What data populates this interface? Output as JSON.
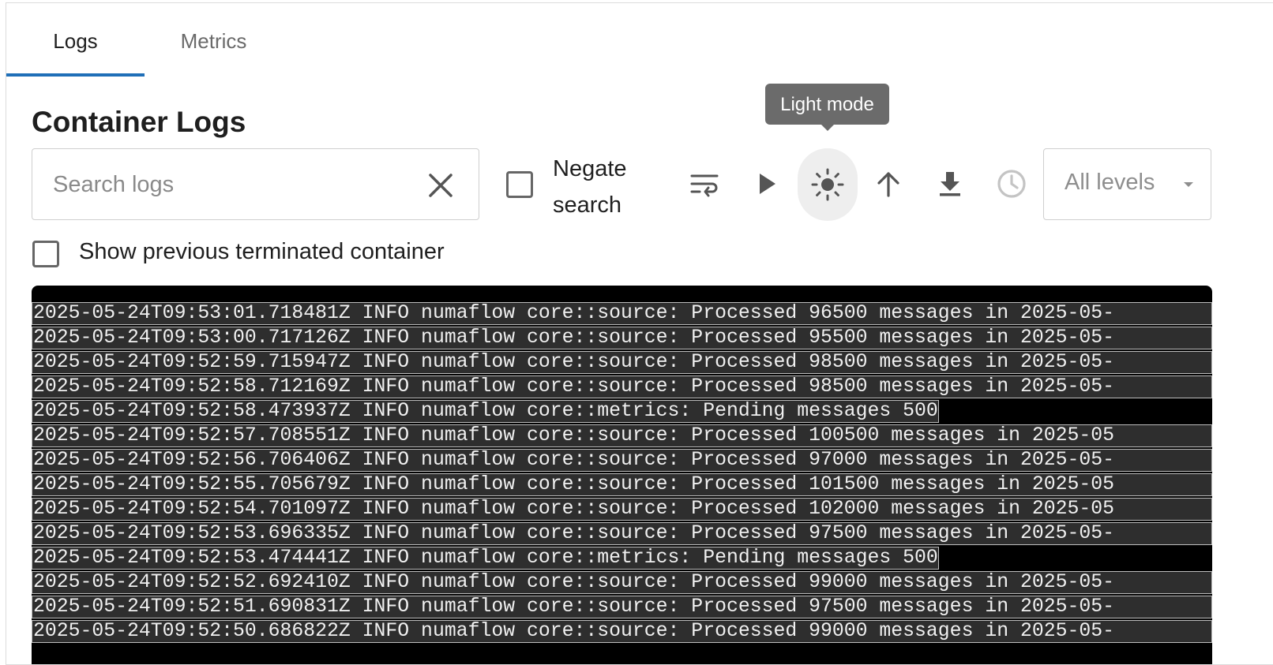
{
  "tabs": [
    {
      "label": "Logs",
      "active": true
    },
    {
      "label": "Metrics",
      "active": false
    }
  ],
  "title": "Container Logs",
  "search": {
    "placeholder": "Search logs",
    "value": ""
  },
  "negate": {
    "label": "Negate search",
    "checked": false
  },
  "toolbar": {
    "icons": [
      "wrap-icon",
      "play-icon",
      "sun-icon",
      "arrow-up-icon",
      "download-icon",
      "clock-icon"
    ],
    "tooltip": "Light mode"
  },
  "level_select": {
    "value": "All levels"
  },
  "show_previous": {
    "label": "Show previous terminated container",
    "checked": false
  },
  "accent_color": "#1f6fb8",
  "logs": [
    {
      "text": "2025-05-24T09:53:01.718481Z INFO numaflow core::source: Processed 96500 messages in 2025-05-",
      "short": false
    },
    {
      "text": "2025-05-24T09:53:00.717126Z INFO numaflow core::source: Processed 95500 messages in 2025-05-",
      "short": false
    },
    {
      "text": "2025-05-24T09:52:59.715947Z INFO numaflow core::source: Processed 98500 messages in 2025-05-",
      "short": false
    },
    {
      "text": "2025-05-24T09:52:58.712169Z INFO numaflow core::source: Processed 98500 messages in 2025-05-",
      "short": false
    },
    {
      "text": "2025-05-24T09:52:58.473937Z INFO numaflow core::metrics: Pending messages 500",
      "short": true
    },
    {
      "text": "2025-05-24T09:52:57.708551Z INFO numaflow core::source: Processed 100500 messages in 2025-05",
      "short": false
    },
    {
      "text": "2025-05-24T09:52:56.706406Z INFO numaflow core::source: Processed 97000 messages in 2025-05-",
      "short": false
    },
    {
      "text": "2025-05-24T09:52:55.705679Z INFO numaflow core::source: Processed 101500 messages in 2025-05",
      "short": false
    },
    {
      "text": "2025-05-24T09:52:54.701097Z INFO numaflow core::source: Processed 102000 messages in 2025-05",
      "short": false
    },
    {
      "text": "2025-05-24T09:52:53.696335Z INFO numaflow core::source: Processed 97500 messages in 2025-05-",
      "short": false
    },
    {
      "text": "2025-05-24T09:52:53.474441Z INFO numaflow core::metrics: Pending messages 500",
      "short": true
    },
    {
      "text": "2025-05-24T09:52:52.692410Z INFO numaflow core::source: Processed 99000 messages in 2025-05-",
      "short": false
    },
    {
      "text": "2025-05-24T09:52:51.690831Z INFO numaflow core::source: Processed 97500 messages in 2025-05-",
      "short": false
    },
    {
      "text": "2025-05-24T09:52:50.686822Z INFO numaflow core::source: Processed 99000 messages in 2025-05-",
      "short": false
    }
  ]
}
